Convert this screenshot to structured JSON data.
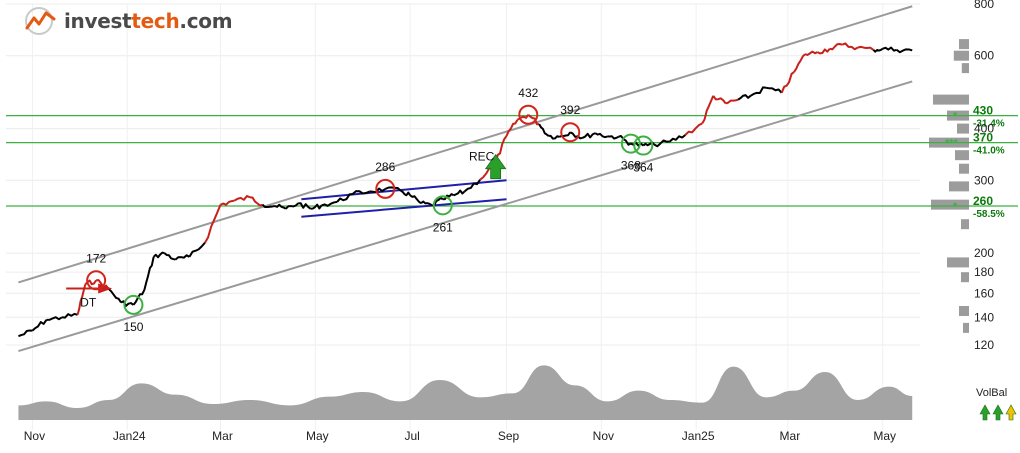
{
  "brand": {
    "name_prefix": "invest",
    "name_accent": "tech",
    "name_suffix": ".com",
    "accent_color": "#e35b12",
    "icon": "trend-logo-icon"
  },
  "colors": {
    "price_up": "#c8201a",
    "price_normal": "#000000",
    "trend_channel": "#9a9a9a",
    "rect_formation": "#1f1fa8",
    "support_resistance": "#3cb043",
    "volume_area": "#a4a4a4",
    "signal_circle_top": "#d2261c",
    "signal_circle_bottom": "#3cb043",
    "buy_arrow": "#2aa02a"
  },
  "chart_data": {
    "type": "line",
    "y_scale": "log",
    "ylim": [
      120,
      800
    ],
    "y_ticks": [
      120,
      140,
      160,
      180,
      200,
      300,
      400,
      600,
      800
    ],
    "x_ticks": [
      "Nov",
      "Jan24",
      "Mar",
      "May",
      "Jul",
      "Sep",
      "Nov",
      "Jan25",
      "Mar",
      "May"
    ],
    "series": [
      {
        "x": [
          "2023-10-23",
          "2023-11-01",
          "2023-11-10",
          "2023-11-20",
          "2023-11-30",
          "2023-12-05",
          "2023-12-12",
          "2023-12-20",
          "2023-12-28",
          "2024-01-05",
          "2024-01-12",
          "2024-01-18",
          "2024-01-25",
          "2024-02-01",
          "2024-02-10",
          "2024-02-20",
          "2024-03-01",
          "2024-03-10",
          "2024-03-20",
          "2024-03-28",
          "2024-04-05",
          "2024-04-12",
          "2024-04-20",
          "2024-04-28",
          "2024-05-05",
          "2024-05-15",
          "2024-05-25",
          "2024-06-05",
          "2024-06-15",
          "2024-06-25",
          "2024-07-01",
          "2024-07-08",
          "2024-07-15",
          "2024-07-22",
          "2024-07-29",
          "2024-08-05",
          "2024-08-15",
          "2024-08-25",
          "2024-09-01",
          "2024-09-08",
          "2024-09-15",
          "2024-09-22",
          "2024-09-28",
          "2024-10-05",
          "2024-10-12",
          "2024-10-20",
          "2024-10-28",
          "2024-11-05",
          "2024-11-12",
          "2024-11-20",
          "2024-11-28",
          "2024-12-05",
          "2024-12-15",
          "2024-12-25",
          "2025-01-05",
          "2025-01-12",
          "2025-01-20",
          "2025-01-28",
          "2025-02-05",
          "2025-02-15",
          "2025-02-25",
          "2025-03-05",
          "2025-03-12",
          "2025-03-20",
          "2025-03-28",
          "2025-04-05",
          "2025-04-15",
          "2025-04-25",
          "2025-05-01",
          "2025-05-10",
          "2025-05-20"
        ],
        "values": [
          126,
          130,
          138,
          140,
          142,
          168,
          172,
          164,
          152,
          150,
          163,
          196,
          200,
          193,
          196,
          212,
          262,
          268,
          273,
          262,
          260,
          256,
          264,
          256,
          261,
          266,
          278,
          282,
          286,
          283,
          276,
          264,
          261,
          270,
          276,
          282,
          301,
          332,
          384,
          420,
          432,
          410,
          384,
          382,
          392,
          380,
          390,
          383,
          382,
          368,
          364,
          366,
          372,
          386,
          412,
          480,
          460,
          470,
          480,
          502,
          488,
          548,
          605,
          612,
          624,
          638,
          628,
          620,
          624,
          620,
          618
        ]
      }
    ],
    "volume_balance": {
      "label": "VolBal",
      "x": [
        "2023-10-23",
        "2023-11-10",
        "2023-11-30",
        "2023-12-20",
        "2024-01-10",
        "2024-02-01",
        "2024-02-25",
        "2024-03-20",
        "2024-04-15",
        "2024-05-10",
        "2024-06-01",
        "2024-06-25",
        "2024-07-20",
        "2024-08-15",
        "2024-09-05",
        "2024-09-25",
        "2024-10-15",
        "2024-11-05",
        "2024-11-25",
        "2024-12-15",
        "2025-01-05",
        "2025-01-25",
        "2025-02-15",
        "2025-03-05",
        "2025-03-25",
        "2025-04-15",
        "2025-05-05",
        "2025-05-20"
      ],
      "values": [
        22,
        28,
        18,
        30,
        55,
        38,
        24,
        30,
        22,
        35,
        42,
        28,
        60,
        34,
        40,
        82,
        52,
        28,
        44,
        30,
        26,
        80,
        34,
        44,
        72,
        30,
        50,
        36
      ]
    },
    "annotations": {
      "support_levels": [
        {
          "value": 430,
          "price_label": "430",
          "pct_label": "-31.4%",
          "stars": "*"
        },
        {
          "value": 370,
          "price_label": "370",
          "pct_label": "-41.0%",
          "stars": "***"
        },
        {
          "value": 260,
          "price_label": "260",
          "pct_label": "-58.5%",
          "stars": "*"
        }
      ],
      "point_labels": [
        {
          "text": "172",
          "x": "2023-12-12",
          "value": 172,
          "side": "top"
        },
        {
          "text": "150",
          "x": "2024-01-05",
          "value": 150,
          "side": "bottom"
        },
        {
          "text": "286",
          "x": "2024-06-15",
          "value": 286,
          "side": "top"
        },
        {
          "text": "261",
          "x": "2024-07-22",
          "value": 261,
          "side": "bottom"
        },
        {
          "text": "432",
          "x": "2024-09-15",
          "value": 432,
          "side": "top"
        },
        {
          "text": "392",
          "x": "2024-10-12",
          "value": 392,
          "side": "top"
        },
        {
          "text": "368",
          "x": "2024-11-20",
          "value": 368,
          "side": "bottom"
        },
        {
          "text": "364",
          "x": "2024-11-28",
          "value": 364,
          "side": "bottom"
        }
      ],
      "signals": [
        {
          "text": "DT",
          "x": "2023-12-12",
          "value": 168
        },
        {
          "text": "REC",
          "x": "2024-08-25",
          "value": 320
        }
      ],
      "trend_channel": {
        "start": "2023-10-23",
        "end": "2025-05-20",
        "upper": [
          170,
          790
        ],
        "lower": [
          116,
          520
        ]
      },
      "rect_formation": {
        "start": "2024-04-22",
        "end": "2024-09-01",
        "upper": [
          270,
          300
        ],
        "lower": [
          245,
          270
        ]
      },
      "volume_profile": [
        {
          "price": 640,
          "size": 0.25
        },
        {
          "price": 600,
          "size": 0.38
        },
        {
          "price": 560,
          "size": 0.18
        },
        {
          "price": 470,
          "size": 0.9
        },
        {
          "price": 430,
          "size": 0.55
        },
        {
          "price": 400,
          "size": 0.3
        },
        {
          "price": 370,
          "size": 1.0
        },
        {
          "price": 345,
          "size": 0.35
        },
        {
          "price": 320,
          "size": 0.25
        },
        {
          "price": 290,
          "size": 0.5
        },
        {
          "price": 262,
          "size": 0.95
        },
        {
          "price": 235,
          "size": 0.2
        },
        {
          "price": 190,
          "size": 0.55
        },
        {
          "price": 175,
          "size": 0.2
        },
        {
          "price": 145,
          "size": 0.25
        },
        {
          "price": 132,
          "size": 0.15
        }
      ]
    }
  }
}
